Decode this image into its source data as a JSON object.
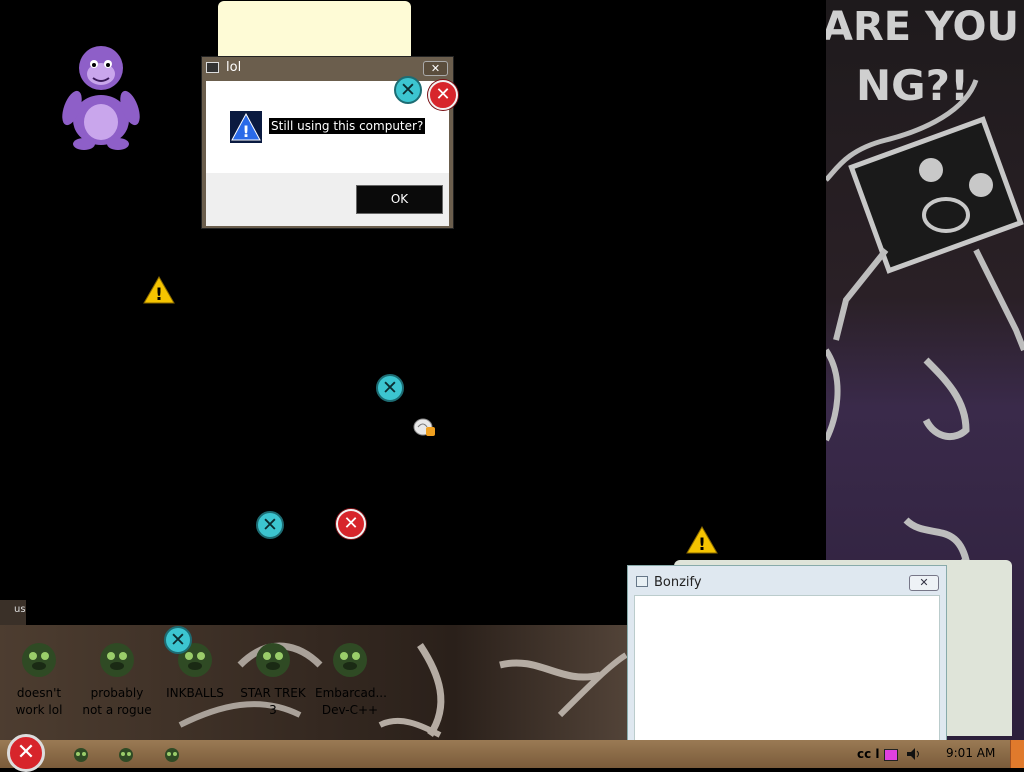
{
  "dialog": {
    "title": "lol",
    "close_glyph": "✕",
    "message": "Still using this computer?",
    "ok_label": "OK",
    "icon": "warning-blue-icon"
  },
  "wallpaper": {
    "scribble_text_1": "ARE YOU",
    "scribble_text_2": "NG?!"
  },
  "desktop_icons": [
    {
      "label": "doesn't work lol"
    },
    {
      "label": "probably not a rogue"
    },
    {
      "label": "INKBALLS"
    },
    {
      "label": "STAR TREK 3"
    },
    {
      "label": "Embarcad... Dev-C++"
    }
  ],
  "partial_label": "us",
  "bonzify": {
    "title": "Bonzify",
    "close_glyph": "✕"
  },
  "taskbar": {
    "start_glyph": "✕",
    "tray_text": "cc l",
    "clock": "9:01 AM"
  },
  "glyphs": {
    "x": "✕"
  }
}
